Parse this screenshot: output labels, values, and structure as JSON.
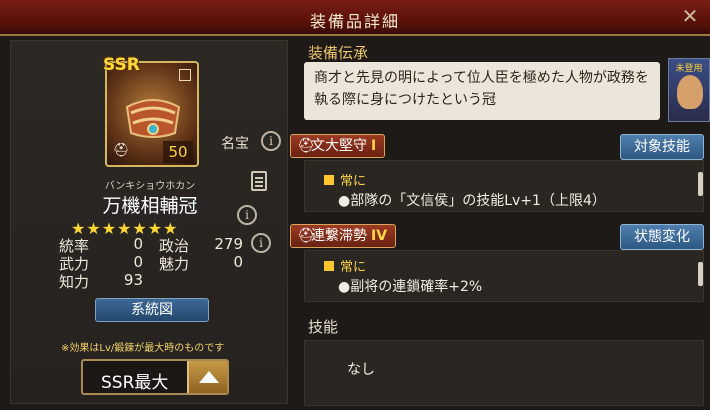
{
  "header": {
    "title": "装備品詳細"
  },
  "equipment": {
    "rarity": "SSR",
    "level": "50",
    "kana": "バンキショウホカン",
    "name": "万機相輔冠",
    "stars": "★★★★★★★",
    "meiho_label": "名宝"
  },
  "stats": {
    "tousotsu_label": "統率",
    "tousotsu": "0",
    "seiji_label": "政治",
    "seiji": "279",
    "buryoku_label": "武力",
    "buryoku": "0",
    "miryoku_label": "魅力",
    "miryoku": "0",
    "chiryoku_label": "知力",
    "chiryoku": "93"
  },
  "buttons": {
    "keitozu": "系統図",
    "target_skill": "対象技能",
    "status_change": "状態変化"
  },
  "footnote": "※効果はLv/鍛錬が最大時のものです",
  "grade_select": {
    "value": "SSR最大"
  },
  "lore": {
    "title": "装備伝承",
    "text": "商才と先見の明によって位人臣を極めた人物が政務を執る際に身につけたという冠"
  },
  "portrait": {
    "tag": "未登用"
  },
  "skill1": {
    "name": "文大堅守",
    "rank": "I",
    "condition": "常に",
    "effect": "●部隊の「文信侯」の技能Lv+1（上限4）"
  },
  "skill2": {
    "name": "連繋滞勢",
    "rank": "IV",
    "condition": "常に",
    "effect": "●副将の連鎖確率+2%"
  },
  "skills": {
    "title": "技能",
    "value": "なし"
  },
  "colors": {
    "accent_gold": "#e9c46d",
    "header_red": "#7a1d12",
    "button_blue": "#3d6a96"
  }
}
